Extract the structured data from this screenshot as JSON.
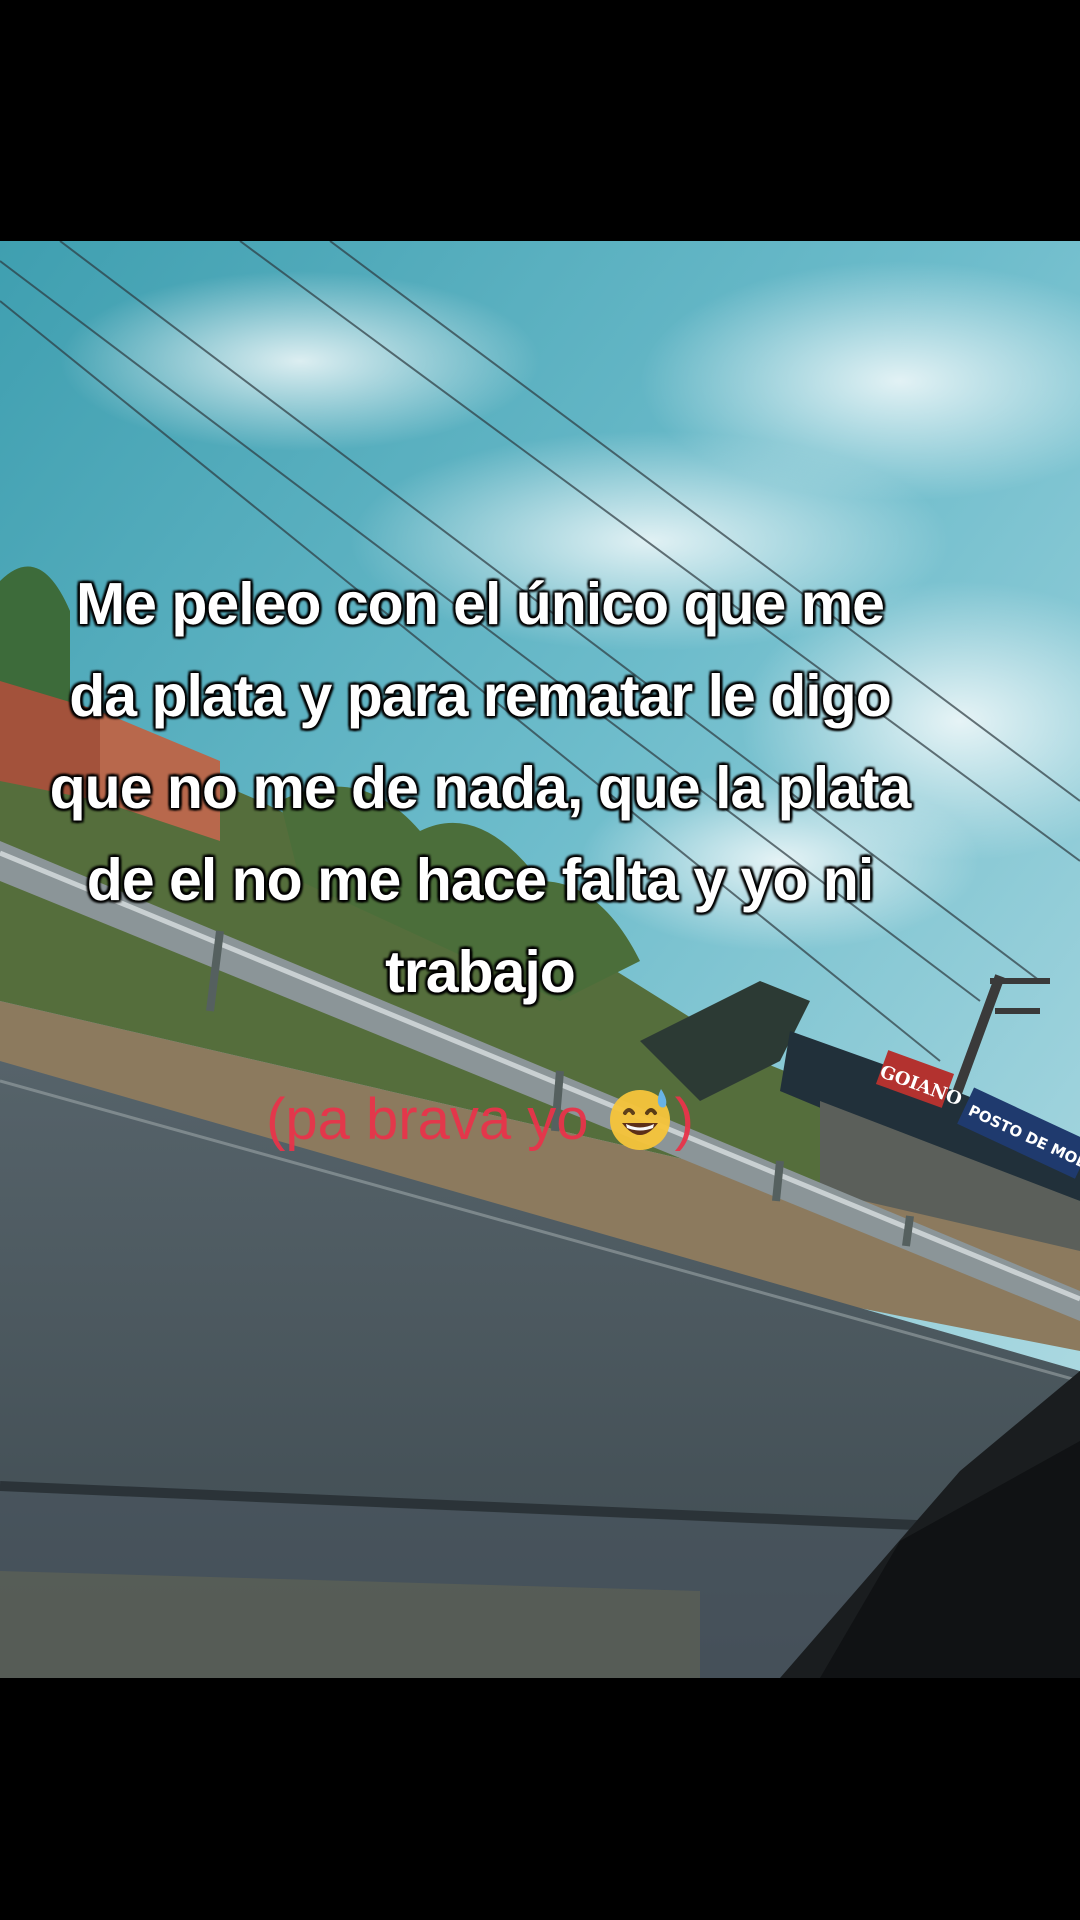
{
  "caption": {
    "lines": [
      "Me peleo con el único que me",
      "da plata y para rematar le digo",
      "que no me de nada, que la plata",
      "de el no me hace falta y yo ni",
      "trabajo"
    ]
  },
  "subcaption": {
    "text_before": "(pa brava yo ",
    "emoji": "grinning-face-with-sweat-icon",
    "text_after": ")",
    "color": "#e8344a"
  },
  "scene": {
    "sign_goiano": "GOIANO",
    "sign_posto": "POSTO DE MOLAS MA"
  }
}
